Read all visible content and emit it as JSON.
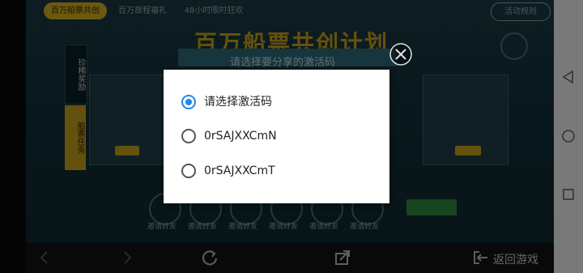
{
  "game": {
    "tabs": [
      "百万船票共创",
      "百万旅程福礼",
      "48小时限时狂欢"
    ],
    "activity_rules": "活动规则",
    "banner_title": "百万船票共创计划",
    "dialog_header": "请选择要分享的激活码",
    "side_tabs": [
      "珍稀奖励",
      "船票任务"
    ],
    "invite_label": "邀请好友"
  },
  "dialog": {
    "selected_index": 0,
    "options": [
      {
        "label": "请选择激活码"
      },
      {
        "label": "0rSAJXXCmN"
      },
      {
        "label": "0rSAJXXCmT"
      }
    ]
  },
  "bottom_nav": {
    "back_to_game": "返回游戏"
  },
  "colors": {
    "radio_selected": "#1e88e5",
    "game_gold": "#c9a21a",
    "game_bg": "#163840"
  }
}
